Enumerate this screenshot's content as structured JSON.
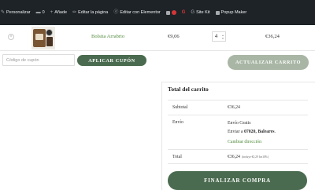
{
  "adminbar": {
    "items": [
      {
        "icon": "brush-icon",
        "label": "Personalizar"
      },
      {
        "icon": "comment-icon",
        "label": "0"
      },
      {
        "icon": "plus-icon",
        "label": "Añade"
      },
      {
        "icon": "pencil-icon",
        "label": "Editar la página"
      },
      {
        "icon": "elementor-icon",
        "label": "Editar con Elementor"
      },
      {
        "icon": "yoast-icon",
        "label": ""
      },
      {
        "icon": "g-icon",
        "label": ""
      },
      {
        "icon": "sitekit-icon",
        "label": "Site Kit"
      },
      {
        "icon": "popup-icon",
        "label": "Popup Maker"
      }
    ]
  },
  "cart": {
    "item": {
      "remove_symbol": "×",
      "name": "Bolsita Arrabrio",
      "price": "€9,06",
      "quantity": "4",
      "subtotal": "€36,24"
    }
  },
  "coupon": {
    "placeholder": "Código de cupón",
    "apply_label": "APLICAR CUPÓN"
  },
  "update_label": "ACTUALIZAR CARRITO",
  "totals": {
    "title": "Total del carrito",
    "subtotal_label": "Subtotal",
    "subtotal_value": "€36,24",
    "shipping_label": "Envío",
    "shipping_method": "Envío Gratis",
    "shipping_to_prefix": "Enviar a",
    "shipping_to_location": "07020, Baleares",
    "shipping_suffix": ".",
    "change_address": "Cambiar dirección",
    "total_label": "Total",
    "total_value": "€36,24",
    "tax_note": "(incluye €3,29 Iva10%)",
    "checkout_label": "FINALIZAR COMPRA"
  },
  "colors": {
    "adminbar_bg": "#1d2327",
    "primary_button": "#4a6b4f",
    "disabled_button": "#a9b6a5",
    "link_green": "#4f8a3b"
  }
}
